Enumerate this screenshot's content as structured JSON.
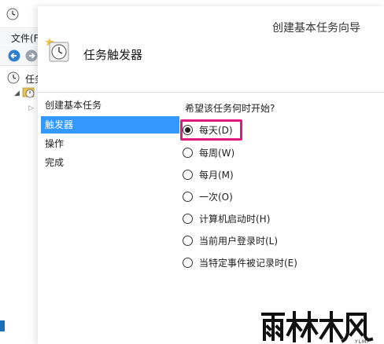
{
  "background_window": {
    "menu_file": "文件(F",
    "tree_root_label": "任务"
  },
  "dialog": {
    "title": "创建基本任务向导",
    "header_title": "任务触发器"
  },
  "steps": [
    {
      "label": "创建基本任务",
      "active": false
    },
    {
      "label": "触发器",
      "active": true
    },
    {
      "label": "操作",
      "active": false
    },
    {
      "label": "完成",
      "active": false
    }
  ],
  "question": "希望该任务何时开始?",
  "options": [
    {
      "label": "每天(D)",
      "checked": true
    },
    {
      "label": "每周(W)",
      "checked": false
    },
    {
      "label": "每月(M)",
      "checked": false
    },
    {
      "label": "一次(O)",
      "checked": false
    },
    {
      "label": "计算机启动时(H)",
      "checked": false
    },
    {
      "label": "当前用户登录时(L)",
      "checked": false
    },
    {
      "label": "当特定事件被记录时(E)",
      "checked": false
    }
  ],
  "colors": {
    "accent": "#3399ff",
    "highlight": "#e0197d"
  },
  "watermark": {
    "brand": "雨林木风",
    "sub": "YLMF"
  }
}
